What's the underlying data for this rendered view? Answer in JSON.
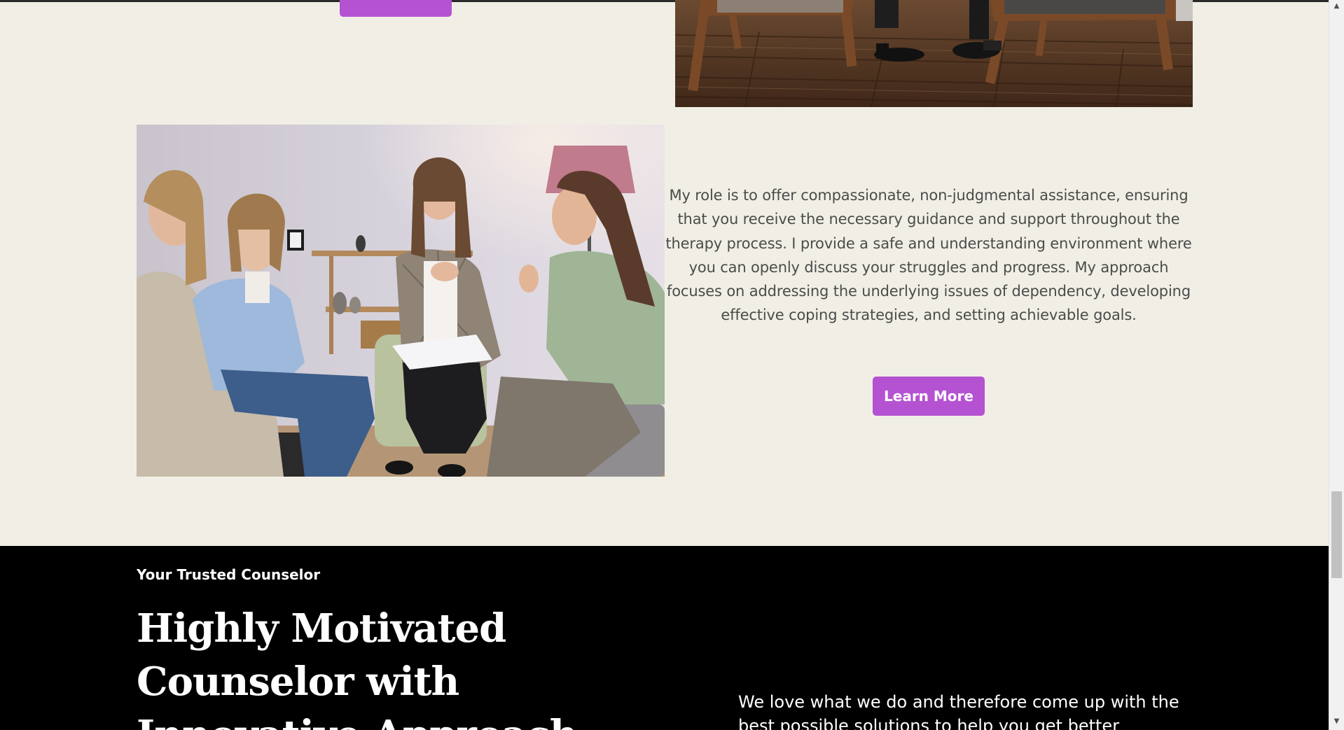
{
  "hero_top": {
    "button_label": ""
  },
  "about": {
    "paragraph": "My role is to offer compassionate, non-judgmental assistance, ensuring that you receive the necessary guidance and support throughout the therapy process. I provide a safe and understanding environment where you can openly discuss your struggles and progress. My approach focuses on addressing the underlying issues of dependency, developing effective coping strategies, and setting achievable goals.",
    "button_label": "Learn More"
  },
  "counselor_section": {
    "eyebrow": "Your Trusted Counselor",
    "headline": "Highly Motivated Counselor with Innovative Approach",
    "intro": "We love what we do and therefore come up with the best possible solutions to help you get better quickly."
  },
  "scrollbar": {
    "up_icon": "triangle-up",
    "down_icon": "triangle-down",
    "position_fraction": 0.68
  },
  "colors": {
    "page_bg": "#f1efe5",
    "accent": "#b552d2",
    "dark_bg": "#000000",
    "body_text": "#4b4b4b"
  }
}
